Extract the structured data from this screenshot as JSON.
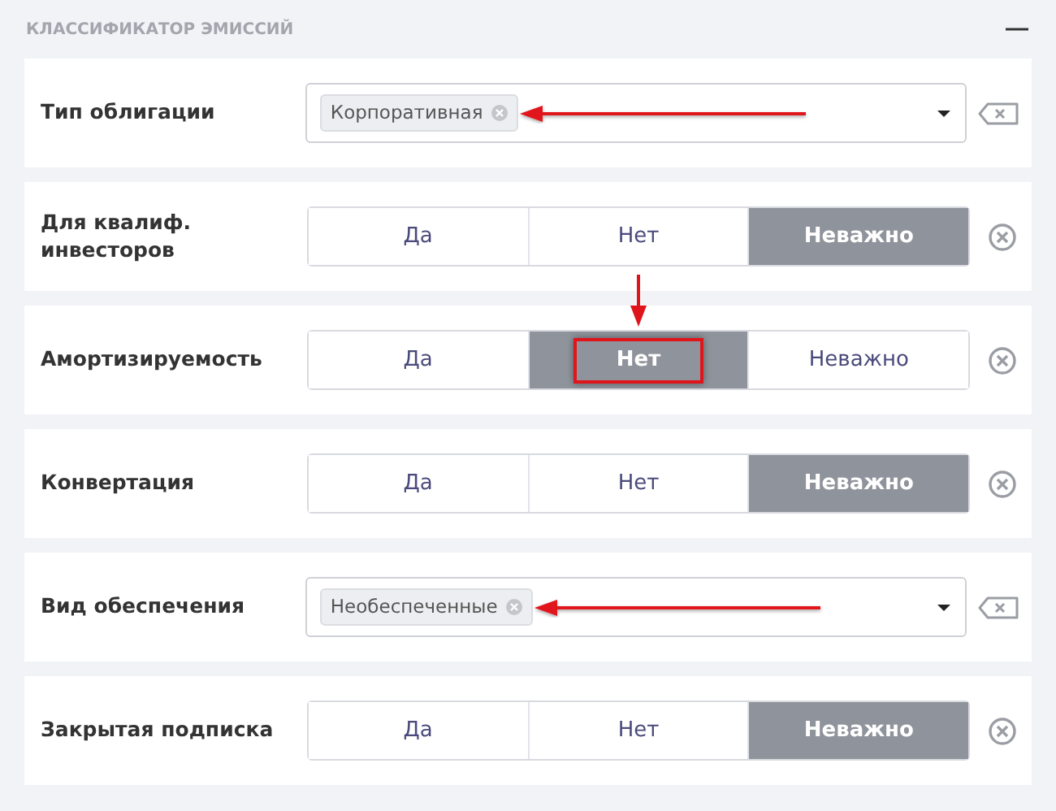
{
  "section": {
    "title": "КЛАССИФИКАТОР ЭМИССИЙ",
    "collapsed": false
  },
  "rows": [
    {
      "kind": "select",
      "label": "Тип облигации",
      "tags": [
        {
          "label": "Корпоративная",
          "annotated": true
        }
      ]
    },
    {
      "kind": "toggle",
      "label": "Для квалиф. инвесторов",
      "options": [
        {
          "label": "Да",
          "selected": false,
          "annotated": false
        },
        {
          "label": "Нет",
          "selected": false,
          "annotated": false
        },
        {
          "label": "Неважно",
          "selected": true,
          "annotated": false
        }
      ]
    },
    {
      "kind": "toggle",
      "label": "Амортизируемость",
      "options": [
        {
          "label": "Да",
          "selected": false,
          "annotated": false
        },
        {
          "label": "Нет",
          "selected": true,
          "annotated": true
        },
        {
          "label": "Неважно",
          "selected": false,
          "annotated": false
        }
      ]
    },
    {
      "kind": "toggle",
      "label": "Конвертация",
      "options": [
        {
          "label": "Да",
          "selected": false,
          "annotated": false
        },
        {
          "label": "Нет",
          "selected": false,
          "annotated": false
        },
        {
          "label": "Неважно",
          "selected": true,
          "annotated": false
        }
      ]
    },
    {
      "kind": "select",
      "label": "Вид обеспечения",
      "tags": [
        {
          "label": "Необеспеченные",
          "annotated": true
        }
      ]
    },
    {
      "kind": "toggle",
      "label": "Закрытая подписка",
      "options": [
        {
          "label": "Да",
          "selected": false,
          "annotated": false
        },
        {
          "label": "Нет",
          "selected": false,
          "annotated": false
        },
        {
          "label": "Неважно",
          "selected": true,
          "annotated": false
        }
      ]
    }
  ]
}
